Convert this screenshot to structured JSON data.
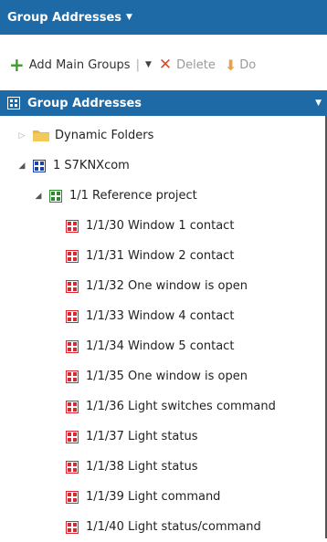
{
  "panel": {
    "title": "Group Addresses"
  },
  "toolbar": {
    "add_main_groups": "Add Main Groups",
    "delete": "Delete",
    "download_partial": "Do"
  },
  "tree": {
    "header": "Group Addresses",
    "dynamic_folders": "Dynamic Folders",
    "main_group": "1 S7KNXcom",
    "middle_group": "1/1 Reference project",
    "addresses": [
      "1/1/30 Window 1 contact",
      "1/1/31 Window 2 contact",
      "1/1/32 One window is open",
      "1/1/33 Window 4 contact",
      "1/1/34 Window 5 contact",
      "1/1/35 One window is open",
      "1/1/36 Light switches command",
      "1/1/37 Light status",
      "1/1/38 Light status",
      "1/1/39 Light command",
      "1/1/40 Light status/command"
    ]
  },
  "colors": {
    "header_bg": "#1d6aa6",
    "main_group_icon": "#1a3fae",
    "middle_group_icon": "#2c8a2c",
    "address_icon": "#d9262f"
  }
}
